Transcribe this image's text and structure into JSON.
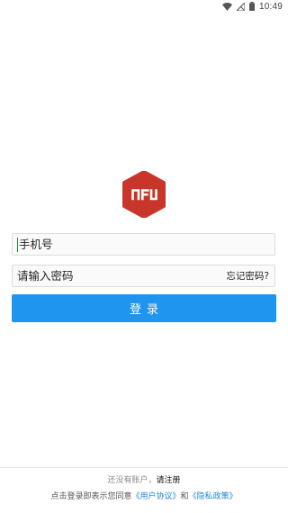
{
  "status_bar": {
    "time": "10:49"
  },
  "brand": {
    "logo_text": "NFU",
    "logo_color": "#c8352a"
  },
  "login_form": {
    "phone_value": "手机号",
    "password_placeholder": "请输入密码",
    "forgot_password_label": "忘记密码?",
    "login_button_label": "登录",
    "accent_color": "#1f95ef"
  },
  "footer": {
    "no_account_text": "还没有账户，",
    "signup_label": "请注册",
    "agreement_prefix": "点击登录即表示您同意",
    "user_agreement_label": "《用户协议》",
    "and_text": "和",
    "privacy_policy_label": "《隐私政策》"
  }
}
